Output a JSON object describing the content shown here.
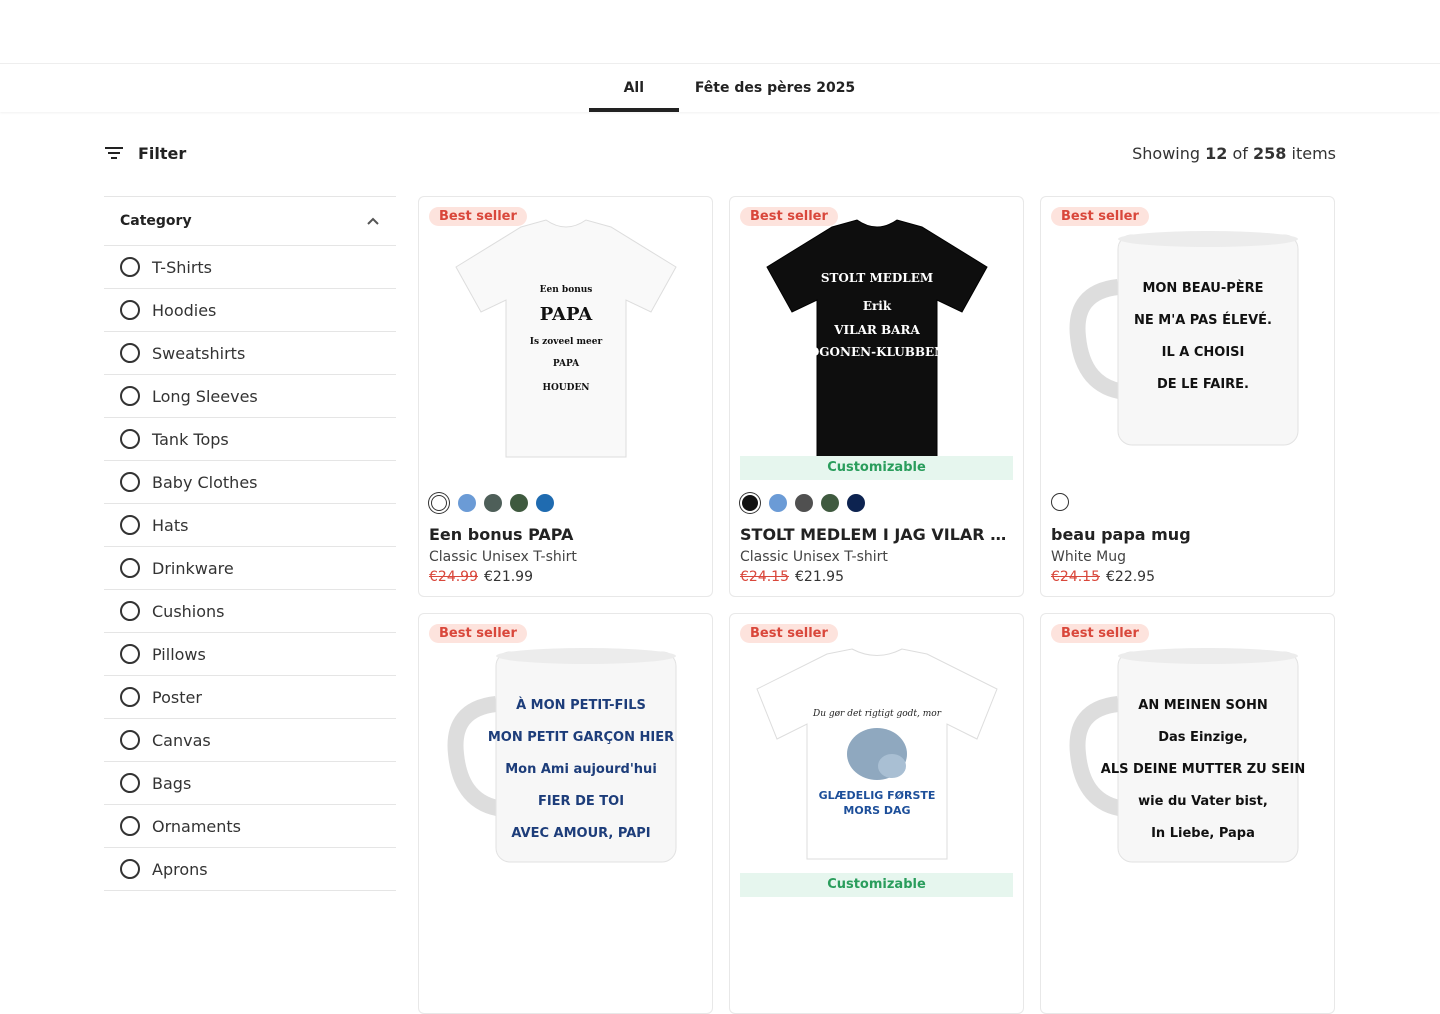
{
  "tabs": [
    {
      "label": "All",
      "active": true
    },
    {
      "label": "Fête des pères 2025",
      "active": false
    }
  ],
  "filter": {
    "label": "Filter"
  },
  "showing": {
    "prefix": "Showing",
    "shown": "12",
    "of": "of",
    "total": "258",
    "suffix": "items"
  },
  "sidebar": {
    "heading": "Category",
    "items": [
      "T-Shirts",
      "Hoodies",
      "Sweatshirts",
      "Long Sleeves",
      "Tank Tops",
      "Baby Clothes",
      "Hats",
      "Drinkware",
      "Cushions",
      "Pillows",
      "Poster",
      "Canvas",
      "Bags",
      "Ornaments",
      "Aprons"
    ]
  },
  "products": [
    {
      "badge": "Best seller",
      "title": "Een bonus PAPA",
      "subtitle": "Classic Unisex T-shirt",
      "old_price": "€24.99",
      "price": "€21.99",
      "customizable": "",
      "image_type": "white-tshirt",
      "image_text": [
        "Een bonus",
        "PAPA",
        "Is zoveel meer",
        "PAPA",
        "HOUDEN"
      ],
      "swatches": [
        "#ffffff",
        "#6b9bd6",
        "#4e5f59",
        "#3f5a3f",
        "#1f6bb0"
      ],
      "selected_swatch": 0
    },
    {
      "badge": "Best seller",
      "title": "STOLT MEDLEM I JAG VILAR BARA ÖGONEN-KLUBBEN",
      "subtitle": "Classic Unisex T-shirt",
      "old_price": "€24.15",
      "price": "€21.95",
      "customizable": "Customizable",
      "image_type": "black-tshirt",
      "image_text": [
        "STOLT MEDLEM",
        "Erik",
        "VILAR BARA",
        "ÖGONEN-KLUBBEN"
      ],
      "swatches": [
        "#111111",
        "#6b9bd6",
        "#505050",
        "#3f5a3f",
        "#0d2350"
      ],
      "selected_swatch": 0
    },
    {
      "badge": "Best seller",
      "title": "beau papa mug",
      "subtitle": "White Mug",
      "old_price": "€24.15",
      "price": "€22.95",
      "customizable": "",
      "image_type": "mug",
      "image_text": [
        "MON BEAU-PÈRE",
        "NE M'A PAS ÉLEVÉ.",
        "IL A CHOISI",
        "DE LE FAIRE."
      ],
      "swatches": [
        "#ffffff"
      ],
      "selected_swatch": -1
    },
    {
      "badge": "Best seller",
      "title": "",
      "subtitle": "",
      "old_price": "",
      "price": "",
      "customizable": "",
      "image_type": "mug-blue",
      "image_text": [
        "À MON PETIT-FILS",
        "MON PETIT GARÇON HIER",
        "Mon Ami aujourd'hui",
        "FIER DE TOI",
        "AVEC AMOUR, PAPI"
      ],
      "swatches": [],
      "selected_swatch": -1
    },
    {
      "badge": "Best seller",
      "title": "",
      "subtitle": "",
      "old_price": "",
      "price": "",
      "customizable": "Customizable",
      "image_type": "white-baby-tshirt",
      "image_text": [
        "Du gør det rigtigt godt, mor",
        "GLÆDELIG FØRSTE",
        "MORS DAG"
      ],
      "swatches": [],
      "selected_swatch": -1
    },
    {
      "badge": "Best seller",
      "title": "",
      "subtitle": "",
      "old_price": "",
      "price": "",
      "customizable": "",
      "image_type": "mug",
      "image_text": [
        "AN MEINEN SOHN",
        "Das Einzige,",
        "ALS DEINE MUTTER ZU SEIN",
        "wie du Vater bist,",
        "In Liebe, Papa"
      ],
      "swatches": [],
      "selected_swatch": -1
    }
  ]
}
